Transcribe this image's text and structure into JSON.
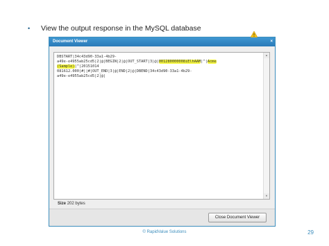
{
  "slide": {
    "bullet_glyph": "•",
    "bullet_text": "View the output response in the MySQL database",
    "copyright": "© RapidValue Solutions",
    "page_number": "29"
  },
  "viewer": {
    "title": "Document Viewer",
    "close_glyph": "×",
    "content_lines": [
      "DBSTART|34c43d90-33a1-4b29-",
      "a49e-e4955ab25cd5|2|@|BEGIN|2|@|OUT_START|3|@|",
      "|^|20151014",
      "081612.000|#||#|OUT_END|3|@|END|2|@|DBEND|34c43d90-33a1-4b29-",
      "a49e-e4955ab25cd5|2|@|"
    ],
    "highlight_1": "001280000008iElhAAM",
    "line2_sep": "|^|",
    "highlight_2a": "Acme",
    "highlight_2b": "(Sample)",
    "size_label": "Size",
    "size_value": "202 bytes",
    "close_button_label": "Close Document Viewer"
  },
  "colors": {
    "accent": "#3c8dbc",
    "highlight": "#f3f43c"
  },
  "icons": [
    "warning-icon",
    "close-icon",
    "scroll-up-icon",
    "scroll-down-icon"
  ]
}
